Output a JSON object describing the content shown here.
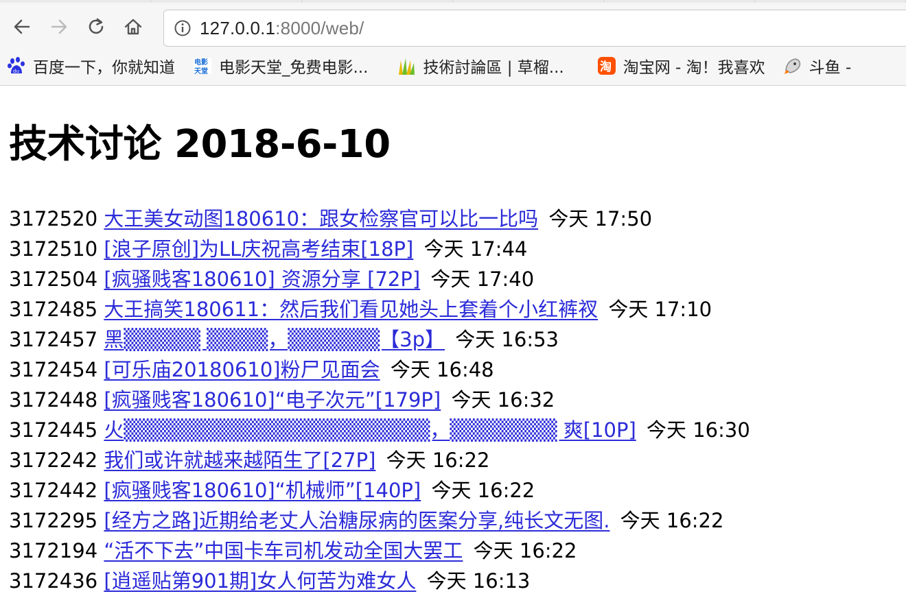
{
  "browser": {
    "url_host": "127.0.0.1",
    "url_rest": ":8000/web/",
    "bookmarks": [
      {
        "label": "百度一下，你就知道",
        "icon": "baidu-icon"
      },
      {
        "label": "电影天堂_免费电影...",
        "icon": "movie-icon"
      },
      {
        "label": "技術討論區 | 草榴...",
        "icon": "grass-icon"
      },
      {
        "label": "淘宝网 - 淘！我喜欢",
        "icon": "taobao-icon"
      },
      {
        "label": "斗鱼 -",
        "icon": "douyu-icon"
      }
    ]
  },
  "page": {
    "title": "技术讨论 2018-6-10",
    "posts": [
      {
        "id": "3172520",
        "title": "大王美女动图180610：跟女检察官可以比一比吗",
        "time": "今天 17:50"
      },
      {
        "id": "3172510",
        "title": "[浪子原创]为LL庆祝高考结束[18P]",
        "time": "今天 17:44"
      },
      {
        "id": "3172504",
        "title": "[疯骚贱客180610] 资源分享 [72P]",
        "time": "今天 17:40"
      },
      {
        "id": "3172485",
        "title": "大王搞笑180611：然后我们看见她头上套着个小红裤衩",
        "time": "今天 17:10"
      },
      {
        "id": "3172457",
        "title": "黑▒▒▒▒▒ ▒▒▒▒，▒▒▒▒▒▒【3p】",
        "time": "今天 16:53"
      },
      {
        "id": "3172454",
        "title": "[可乐庙20180610]粉尸见面会",
        "time": "今天 16:48"
      },
      {
        "id": "3172448",
        "title": "[疯骚贱客180610]“电子次元”[179P]",
        "time": "今天 16:32"
      },
      {
        "id": "3172445",
        "title": "火▒▒▒▒▒▒▒▒▒▒▒▒▒▒▒▒▒▒▒▒，▒▒▒▒▒▒▒ 爽[10P]",
        "time": "今天 16:30"
      },
      {
        "id": "3172242",
        "title": "我们或许就越来越陌生了[27P]",
        "time": "今天 16:22"
      },
      {
        "id": "3172442",
        "title": "[疯骚贱客180610]“机械师”[140P]",
        "time": "今天 16:22"
      },
      {
        "id": "3172295",
        "title": "[经方之路]近期给老丈人治糖尿病的医案分享,纯长文无图.",
        "time": "今天 16:22"
      },
      {
        "id": "3172194",
        "title": "“活不下去”中国卡车司机发动全国大罢工",
        "time": "今天 16:22"
      },
      {
        "id": "3172436",
        "title": "[逍遥贴第901期]女人何苦为难女人",
        "time": "今天 16:13"
      }
    ]
  }
}
